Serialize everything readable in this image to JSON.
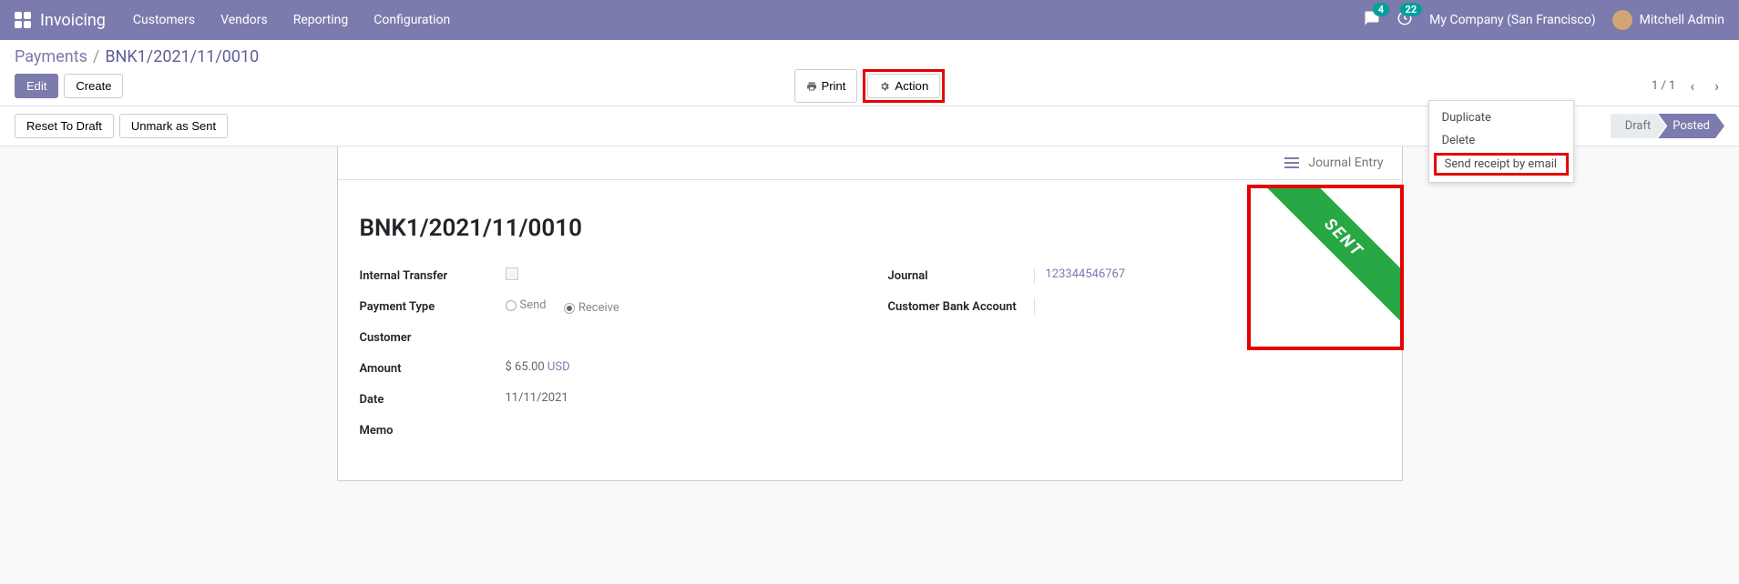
{
  "topnav": {
    "brand": "Invoicing",
    "items": [
      "Customers",
      "Vendors",
      "Reporting",
      "Configuration"
    ],
    "chat_badge": "4",
    "clock_badge": "22",
    "company": "My Company (San Francisco)",
    "user": "Mitchell Admin"
  },
  "breadcrumb": {
    "root": "Payments",
    "current": "BNK1/2021/11/0010"
  },
  "buttons": {
    "edit": "Edit",
    "create": "Create",
    "print": "Print",
    "action": "Action",
    "reset_draft": "Reset To Draft",
    "unmark_sent": "Unmark as Sent"
  },
  "action_menu": {
    "duplicate": "Duplicate",
    "delete": "Delete",
    "send_receipt": "Send receipt by email"
  },
  "pager": {
    "text": "1 / 1"
  },
  "status": {
    "draft": "Draft",
    "posted": "Posted"
  },
  "journal_entry_label": "Journal Entry",
  "ribbon": "SENT",
  "record": {
    "title": "BNK1/2021/11/0010",
    "labels": {
      "internal_transfer": "Internal Transfer",
      "payment_type": "Payment Type",
      "customer": "Customer",
      "amount": "Amount",
      "date": "Date",
      "memo": "Memo",
      "journal": "Journal",
      "cust_bank_acc": "Customer Bank Account"
    },
    "payment_type_send": "Send",
    "payment_type_receive": "Receive",
    "amount": "$ 65.00",
    "currency": "USD",
    "date": "11/11/2021",
    "journal": "123344546767"
  }
}
